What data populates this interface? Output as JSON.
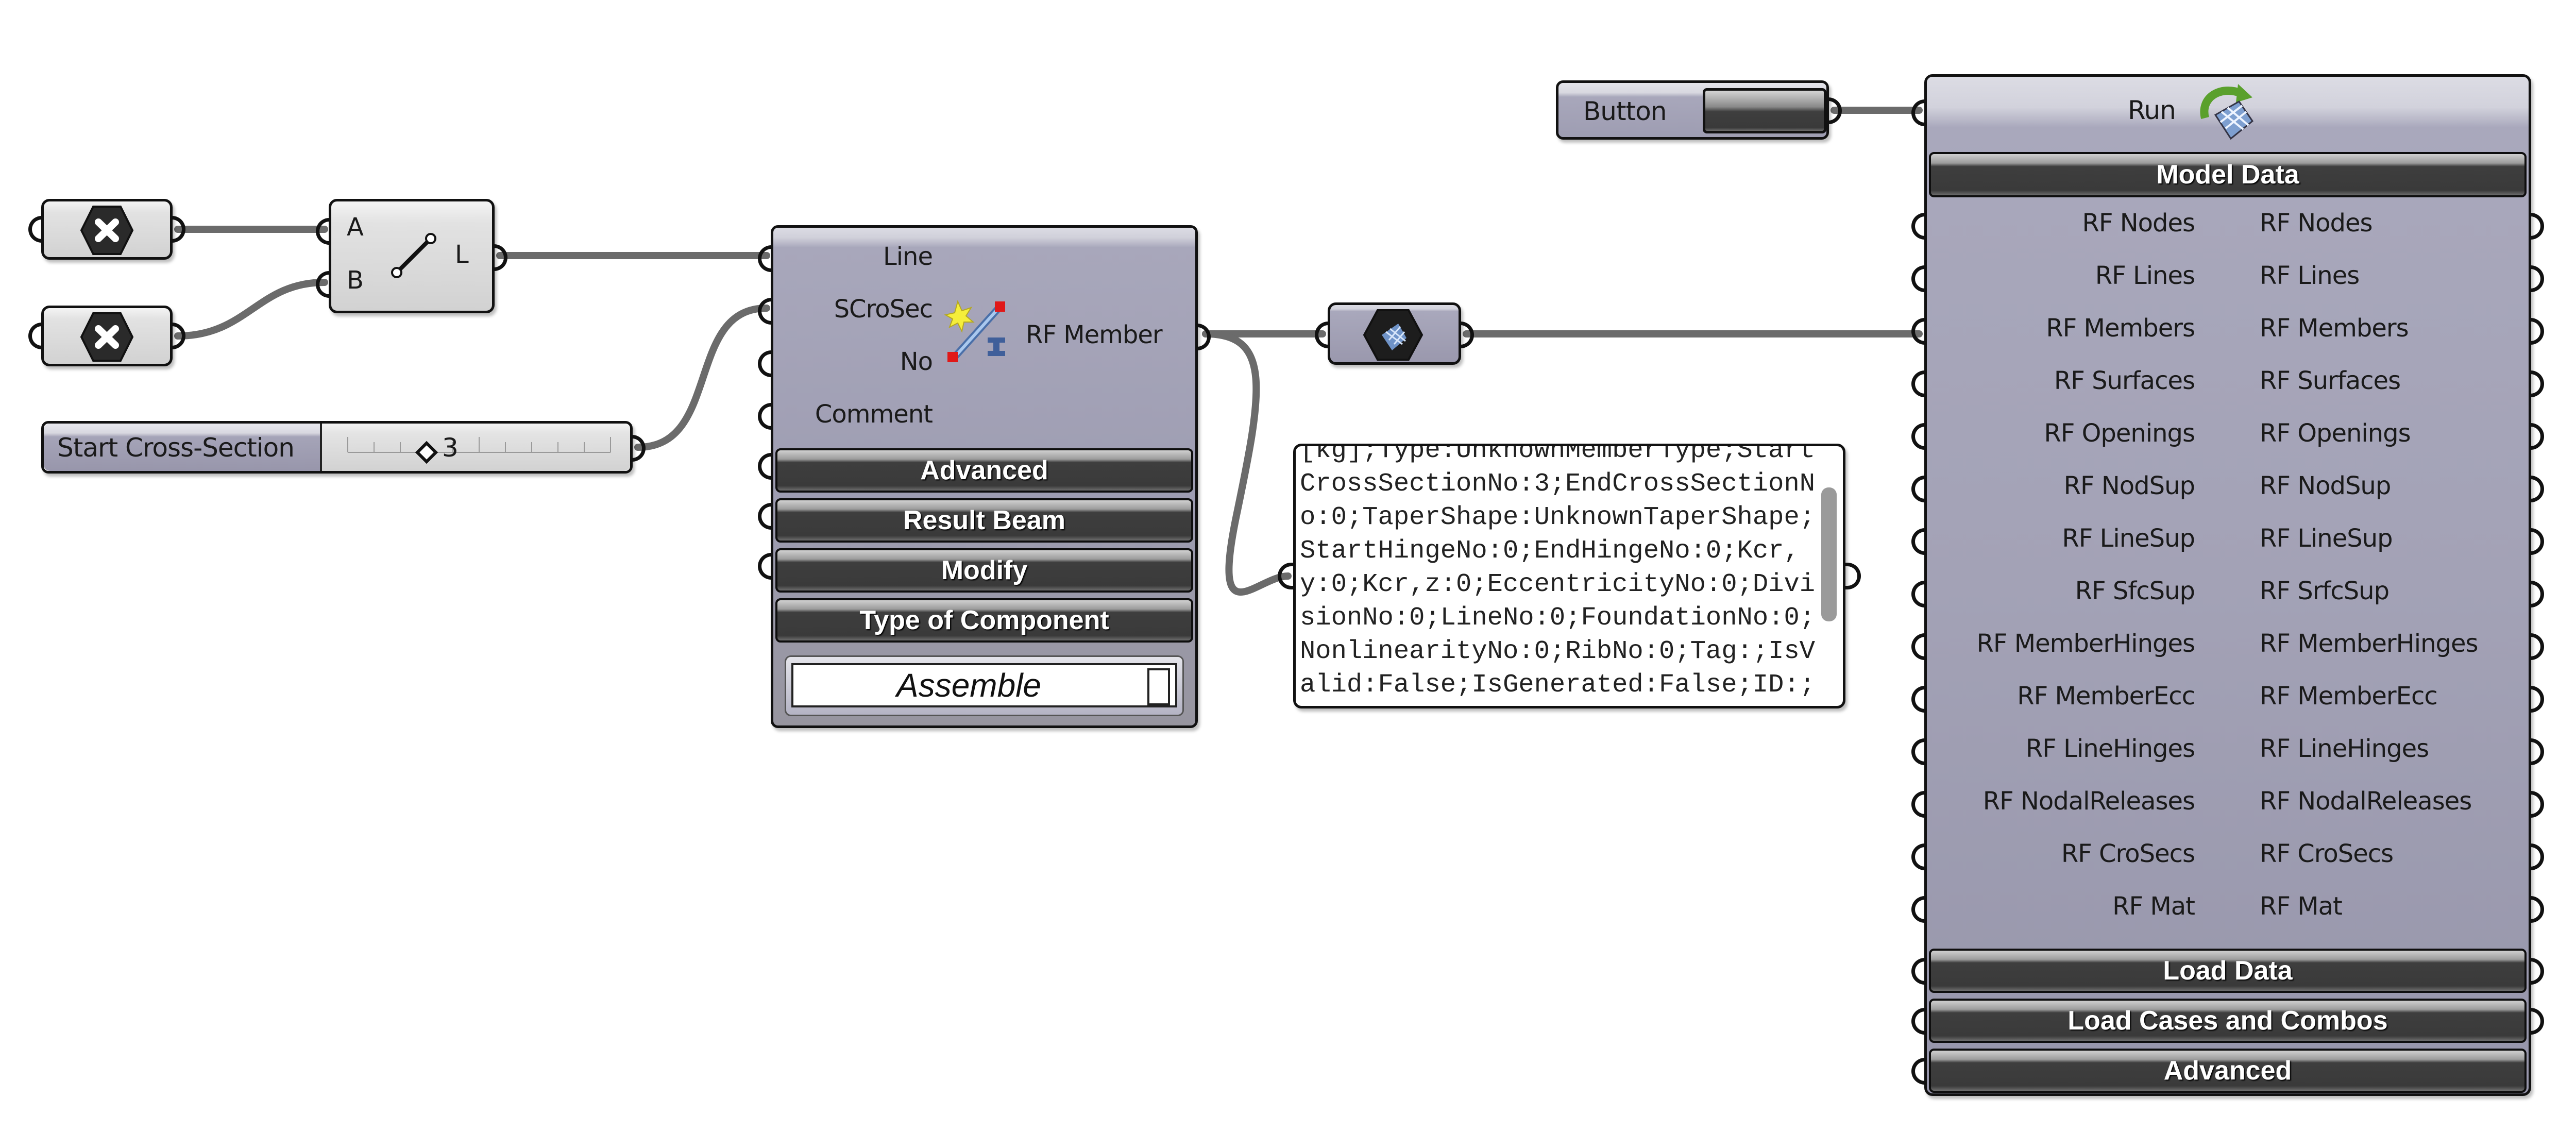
{
  "canvas": {
    "background": "#ffffff",
    "wire_color": "#6b6b6b"
  },
  "point_params": [
    {
      "icon": "point-param-icon"
    },
    {
      "icon": "point-param-icon"
    }
  ],
  "line_component": {
    "inputs": [
      "A",
      "B"
    ],
    "outputs": [
      "L"
    ],
    "icon": "line-icon"
  },
  "slider": {
    "label": "Start Cross-Section",
    "value": "3",
    "value_fraction": 0.3,
    "tick_count": 10
  },
  "rf_member": {
    "inputs": [
      "Line",
      "SCroSec",
      "No",
      "Comment"
    ],
    "output": "RF Member",
    "icon": "rf-member-icon",
    "sections": [
      "Advanced",
      "Result Beam",
      "Modify",
      "Type of Component"
    ],
    "dropdown_value": "Assemble"
  },
  "member_param": {
    "icon": "rf-model-param-icon"
  },
  "panel": {
    "text": "[kg];Type:UnknownMemberType;StartCrossSectionNo:3;EndCrossSectionNo:0;TaperShape:UnknownTaperShape;StartHingeNo:0;EndHingeNo:0;Kcr,y:0;Kcr,z:0;EccentricityNo:0;DivisionNo:0;LineNo:0;FoundationNo:0;NonlinearityNo:0;RibNo:0;Tag:;IsValid:False;IsGenerated:False;ID:;Rotatio"
  },
  "button": {
    "label": "Button"
  },
  "model_component": {
    "run_label": "Run",
    "run_icon": "run-model-icon",
    "header_section": "Model Data",
    "rows": [
      {
        "input": "RF Nodes",
        "output": "RF Nodes"
      },
      {
        "input": "RF Lines",
        "output": "RF Lines"
      },
      {
        "input": "RF Members",
        "output": "RF Members"
      },
      {
        "input": "RF Surfaces",
        "output": "RF Surfaces"
      },
      {
        "input": "RF Openings",
        "output": "RF Openings"
      },
      {
        "input": "RF NodSup",
        "output": "RF NodSup"
      },
      {
        "input": "RF LineSup",
        "output": "RF LineSup"
      },
      {
        "input": "RF SfcSup",
        "output": "RF SrfcSup"
      },
      {
        "input": "RF MemberHinges",
        "output": "RF MemberHinges"
      },
      {
        "input": "RF MemberEcc",
        "output": "RF MemberEcc"
      },
      {
        "input": "RF LineHinges",
        "output": "RF LineHinges"
      },
      {
        "input": "RF NodalReleases",
        "output": "RF NodalReleases"
      },
      {
        "input": "RF CroSecs",
        "output": "RF CroSecs"
      },
      {
        "input": "RF Mat",
        "output": "RF Mat"
      }
    ],
    "footer_sections": [
      "Load Data",
      "Load Cases and Combos",
      "Advanced"
    ]
  }
}
